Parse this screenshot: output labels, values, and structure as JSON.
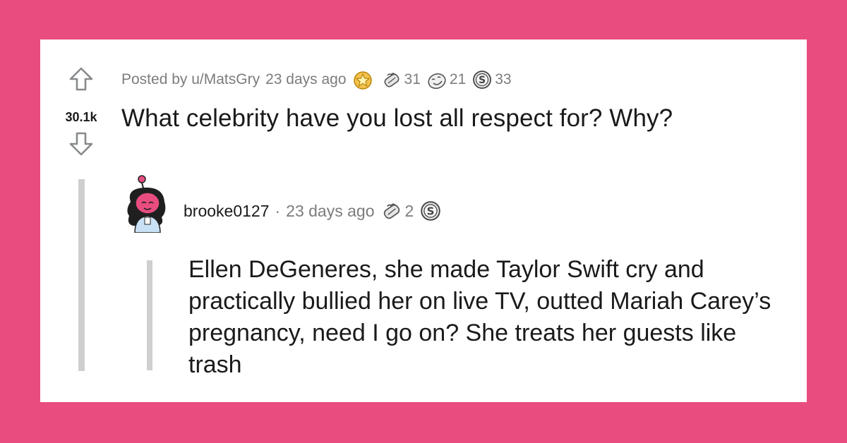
{
  "post": {
    "score": "30.1k",
    "posted_by": "Posted by u/MatsGry",
    "time": "23 days ago",
    "awards": [
      {
        "icon": "gold-award-icon",
        "count": ""
      },
      {
        "icon": "wholesome-award-icon",
        "count": "31"
      },
      {
        "icon": "laughing-award-icon",
        "count": "21"
      },
      {
        "icon": "silver-award-icon",
        "count": "33"
      }
    ],
    "title": "What celebrity have you lost all respect for? Why?"
  },
  "comment": {
    "author": "brooke0127",
    "separator": "·",
    "time": "23 days ago",
    "awards": [
      {
        "icon": "wholesome-award-icon",
        "count": "2"
      },
      {
        "icon": "silver-award-icon",
        "count": ""
      }
    ],
    "body": "Ellen DeGeneres, she made Taylor Swift cry and practically bullied her on live TV, outted Mariah Carey’s pregnancy, need I go on? She treats her guests like trash"
  },
  "colors": {
    "background": "#e94d80",
    "card": "#ffffff",
    "text": "#1a1a1b",
    "meta": "#7c7c7c",
    "thread_line": "#cfcfcf"
  }
}
